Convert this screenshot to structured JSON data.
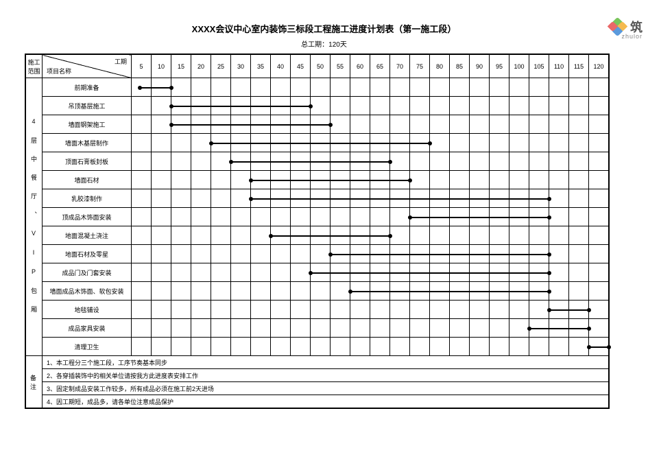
{
  "header": {
    "title": "XXXX会议中心室内装饰三标段工程施工进度计划表（第一施工段）",
    "subtitle": "总工期：120天"
  },
  "watermark": {
    "brand_cn_partial": "筑",
    "brand_en": "zhulor"
  },
  "axis": {
    "label_duration": "工期",
    "label_item": "项目名称",
    "ticks": [
      5,
      10,
      15,
      20,
      25,
      30,
      35,
      40,
      45,
      50,
      55,
      60,
      65,
      70,
      75,
      80,
      85,
      90,
      95,
      100,
      105,
      110,
      115,
      120
    ]
  },
  "scope": {
    "hdr_scope": "施工范围",
    "label": "4 层 中 餐 厅 、 V I P 包 厢"
  },
  "chart_data": {
    "type": "bar",
    "title": "XXXX会议中心室内装饰三标段工程施工进度计划表（第一施工段）",
    "xlabel": "工期（天）",
    "ylabel": "项目名称",
    "xlim": [
      0,
      120
    ],
    "series": [
      {
        "name": "前期准备",
        "start": 2,
        "end": 10
      },
      {
        "name": "吊顶基层施工",
        "start": 10,
        "end": 45
      },
      {
        "name": "墙面钢架施工",
        "start": 10,
        "end": 50
      },
      {
        "name": "墙面木基层制作",
        "start": 20,
        "end": 75
      },
      {
        "name": "顶面石膏板封板",
        "start": 25,
        "end": 65
      },
      {
        "name": "墙面石材",
        "start": 30,
        "end": 70
      },
      {
        "name": "乳胶漆制作",
        "start": 30,
        "end": 105
      },
      {
        "name": "顶成品木饰面安装",
        "start": 70,
        "end": 105
      },
      {
        "name": "地面混凝土浇注",
        "start": 35,
        "end": 65
      },
      {
        "name": "地面石材及零星",
        "start": 50,
        "end": 105
      },
      {
        "name": "成品门及门套安装",
        "start": 45,
        "end": 105
      },
      {
        "name": "墙面成品木饰面、软包安装",
        "start": 55,
        "end": 105
      },
      {
        "name": "地毯铺设",
        "start": 105,
        "end": 115
      },
      {
        "name": "成品家具安装",
        "start": 100,
        "end": 115
      },
      {
        "name": "清理卫生",
        "start": 115,
        "end": 120
      }
    ]
  },
  "notes": {
    "label": "备注",
    "items": [
      "1、本工程分三个施工段，工序节奏基本同步",
      "2、各穿插装饰中的相关单位请按我方此进度表安排工作",
      "3、固定制成品安装工作较多，所有成品必须在施工前2天进场",
      "4、因工期短，成品多，请各单位注意成品保护"
    ]
  }
}
